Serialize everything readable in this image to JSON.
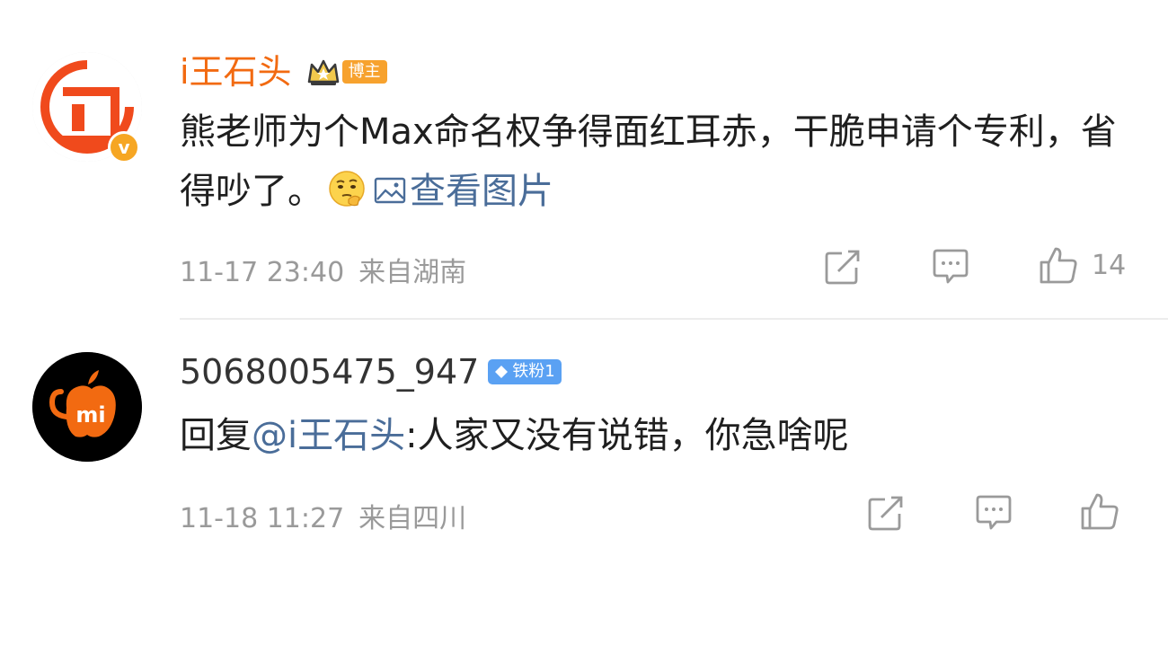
{
  "comments": [
    {
      "author": "i王石头",
      "badge_label": "博主",
      "text_main": "熊老师为个Max命名权争得面红耳赤，干脆申请个专利，省得吵了。",
      "view_image_label": "查看图片",
      "time": "11-17 23:40",
      "location": "来自湖南",
      "like_count": "14",
      "name_color": "#f26a11",
      "badge_color": "#f7a22e"
    },
    {
      "author": "5068005475_947",
      "badge_label": "铁粉1",
      "reply_prefix": "回复",
      "reply_mention": "@i王石头",
      "reply_text": ":人家又没有说错，你急啥呢",
      "time": "11-18 11:27",
      "location": "来自四川",
      "name_color": "#333333",
      "badge_color": "#5aa1f3",
      "avatar_text": "mi"
    }
  ]
}
